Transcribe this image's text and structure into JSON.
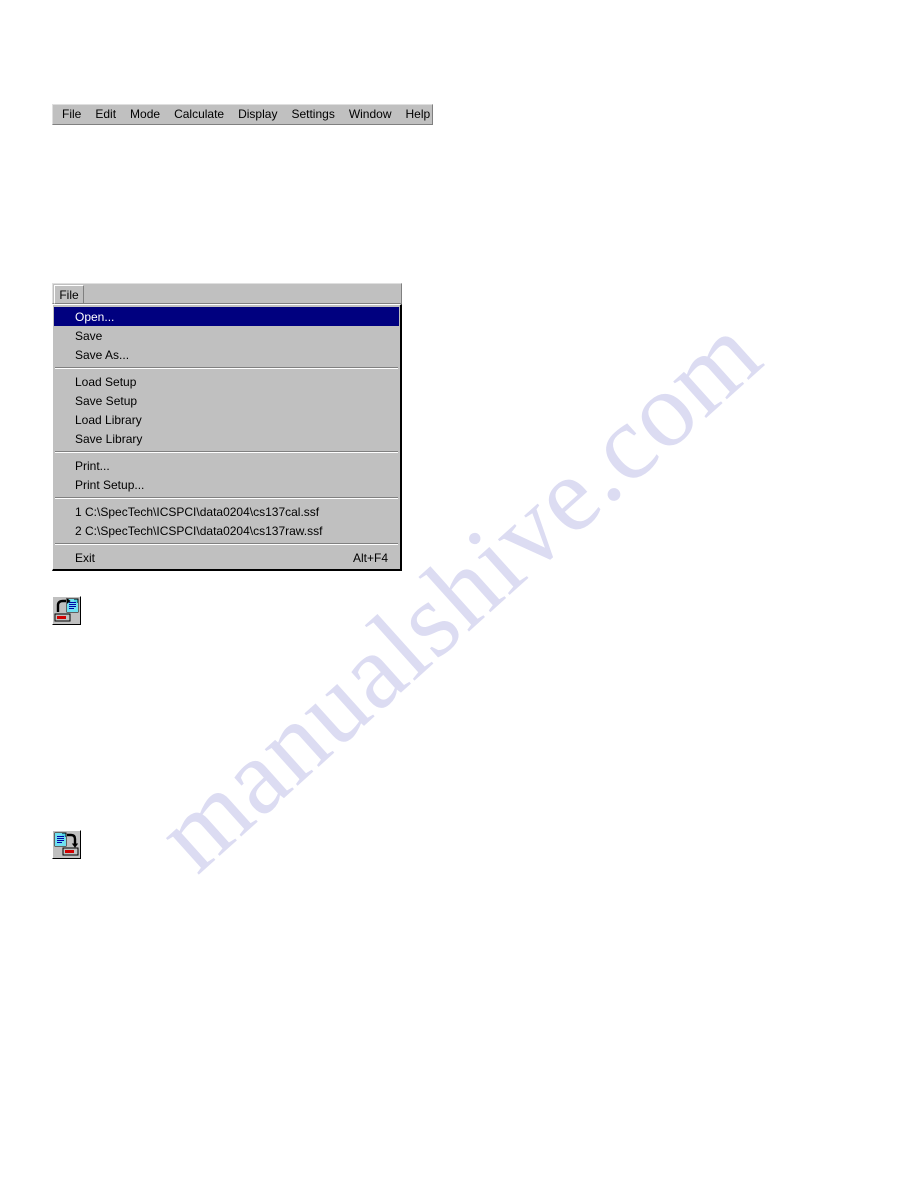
{
  "menubar": {
    "items": [
      {
        "label": "File"
      },
      {
        "label": "Edit"
      },
      {
        "label": "Mode"
      },
      {
        "label": "Calculate"
      },
      {
        "label": "Display"
      },
      {
        "label": "Settings"
      },
      {
        "label": "Window"
      },
      {
        "label": "Help"
      }
    ]
  },
  "dropdown": {
    "tab_label": "File",
    "groups": [
      {
        "items": [
          {
            "label": "Open...",
            "accel": "",
            "selected": true
          },
          {
            "label": "Save",
            "accel": "",
            "selected": false
          },
          {
            "label": "Save As...",
            "accel": "",
            "selected": false
          }
        ]
      },
      {
        "items": [
          {
            "label": "Load Setup",
            "accel": "",
            "selected": false
          },
          {
            "label": "Save Setup",
            "accel": "",
            "selected": false
          },
          {
            "label": "Load Library",
            "accel": "",
            "selected": false
          },
          {
            "label": "Save Library",
            "accel": "",
            "selected": false
          }
        ]
      },
      {
        "items": [
          {
            "label": "Print...",
            "accel": "",
            "selected": false
          },
          {
            "label": "Print Setup...",
            "accel": "",
            "selected": false
          }
        ]
      },
      {
        "items": [
          {
            "label": "1 C:\\SpecTech\\ICSPCI\\data0204\\cs137cal.ssf",
            "accel": "",
            "selected": false
          },
          {
            "label": "2 C:\\SpecTech\\ICSPCI\\data0204\\cs137raw.ssf",
            "accel": "",
            "selected": false
          }
        ]
      },
      {
        "items": [
          {
            "label": "Exit",
            "accel": "Alt+F4",
            "selected": false
          }
        ]
      }
    ]
  },
  "toolbar_buttons": [
    {
      "name": "open-file-button",
      "icon": "open-file-icon"
    },
    {
      "name": "save-file-button",
      "icon": "save-file-icon"
    }
  ],
  "watermark": {
    "text": "manualshive.com",
    "color": "#dcdcf2"
  },
  "colors": {
    "face": "#c0c0c0",
    "highlight_bg": "#00007f",
    "highlight_fg": "#ffffff",
    "icon_blue": "#0000a8",
    "icon_paper": "#3cc8e0",
    "icon_red": "#d00000"
  }
}
